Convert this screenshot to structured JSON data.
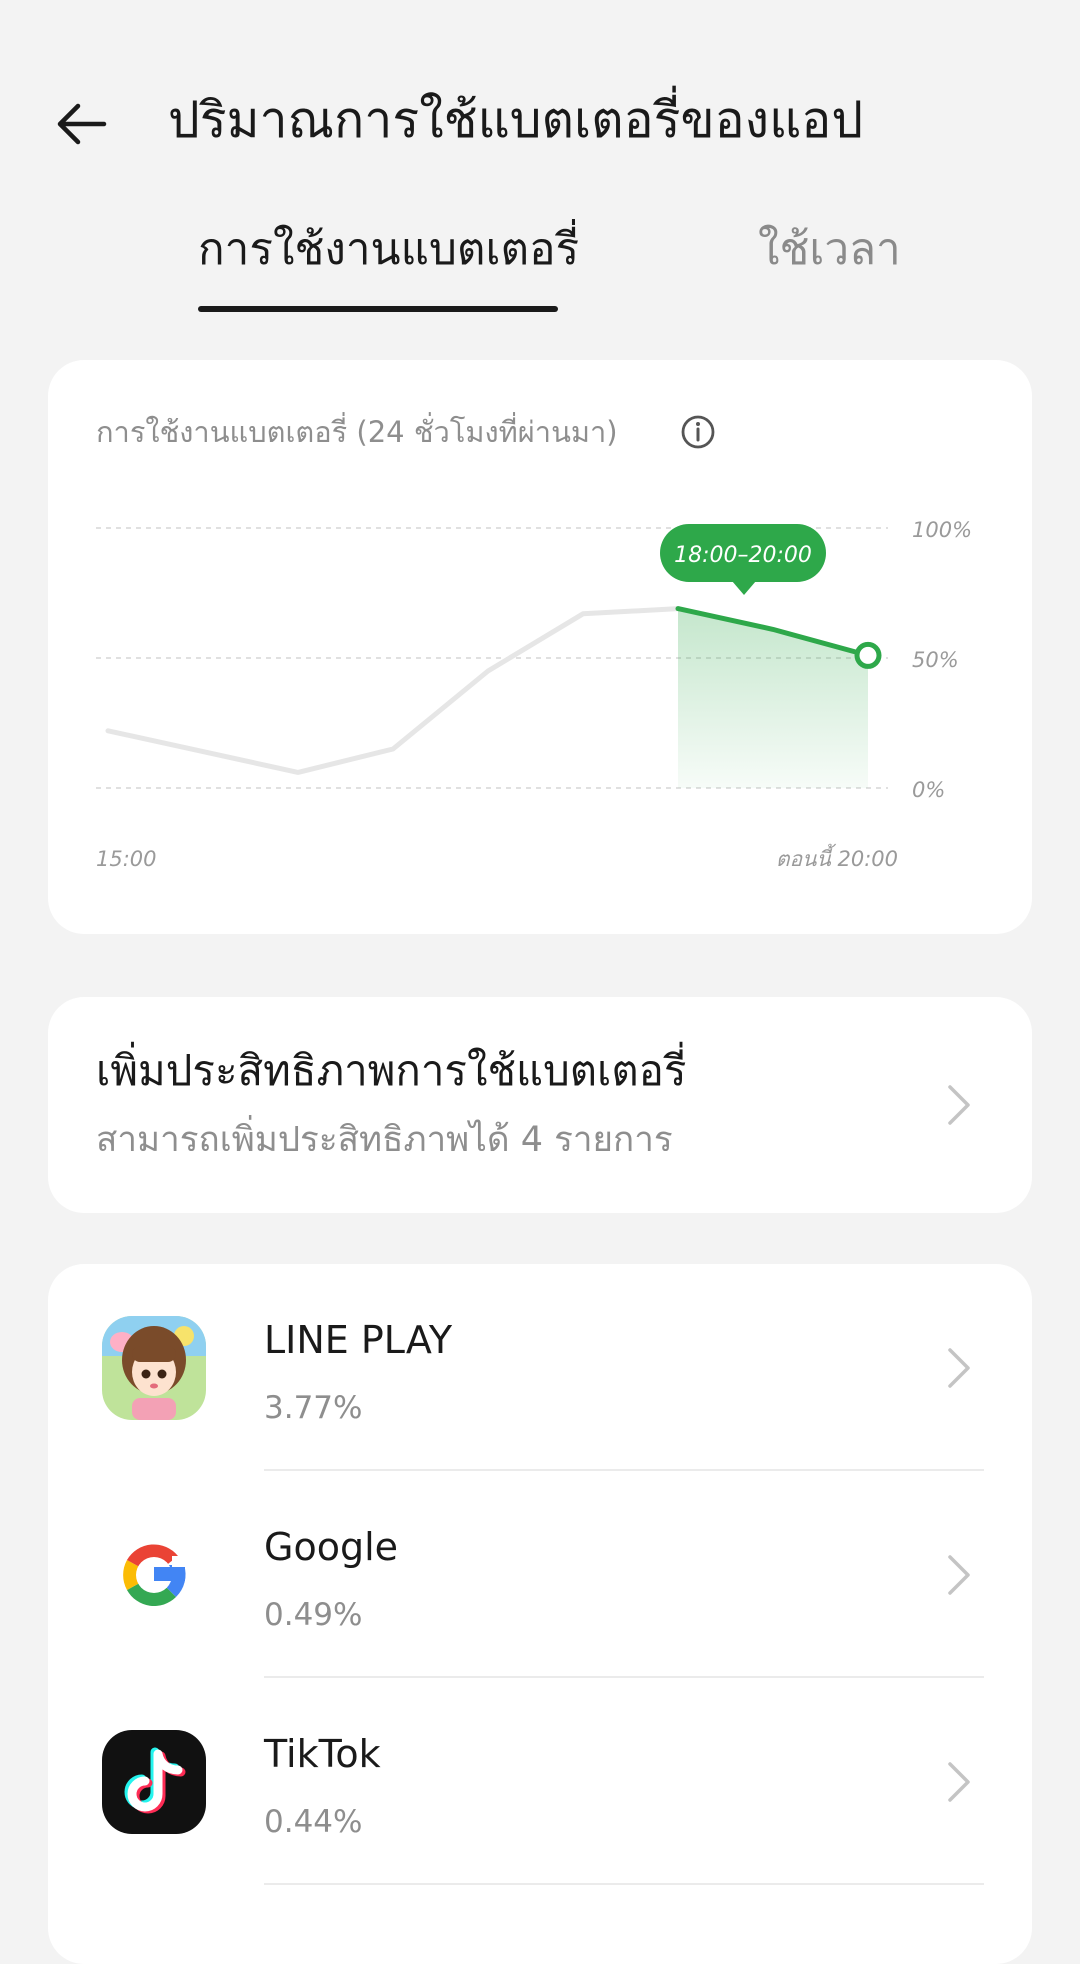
{
  "header": {
    "title": "ปริมาณการใช้แบตเตอรี่ของแอป",
    "back_icon": "arrow-left-icon"
  },
  "tabs": [
    {
      "label": "การใช้งานแบตเตอรี่",
      "active": true
    },
    {
      "label": "ใช้เวลา",
      "active": false
    }
  ],
  "chart_card": {
    "title": "การใช้งานแบตเตอรี่ (24 ชั่วโมงที่ผ่านมา)",
    "info_icon": "info-icon",
    "tooltip": "18:00–20:00",
    "x_start_label": "15:00",
    "x_end_label": "ตอนนี้ 20:00",
    "y_labels": [
      "100%",
      "50%",
      "0%"
    ]
  },
  "chart_data": {
    "type": "line",
    "title": "การใช้งานแบตเตอรี่ (24 ชั่วโมงที่ผ่านมา)",
    "x_labels": [
      "15:00",
      "ตอนนี้ 20:00"
    ],
    "y_ticks": [
      "0%",
      "50%",
      "100%"
    ],
    "ylim": [
      0,
      100
    ],
    "grid": true,
    "series": [
      {
        "values": [
          22,
          14,
          6,
          15,
          45,
          67,
          69,
          61,
          51
        ],
        "color_inactive": "#e6e6e6",
        "color_active": "#2ea84a",
        "highlight_range": "18:00–20:00"
      }
    ]
  },
  "optimize": {
    "title": "เพิ่มประสิทธิภาพการใช้แบตเตอรี่",
    "subtitle": "สามารถเพิ่มประสิทธิภาพได้ 4 รายการ"
  },
  "apps": [
    {
      "name": "LINE PLAY",
      "percent": "3.77%",
      "icon": "line-play-app-icon"
    },
    {
      "name": "Google",
      "percent": "0.49%",
      "icon": "google-app-icon"
    },
    {
      "name": "TikTok",
      "percent": "0.44%",
      "icon": "tiktok-app-icon"
    }
  ],
  "colors": {
    "accent": "#2ea84a",
    "background": "#f3f3f3",
    "card": "#ffffff",
    "secondary_text": "#8e8e8e"
  }
}
